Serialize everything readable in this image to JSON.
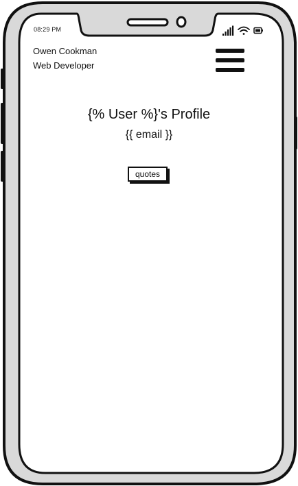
{
  "status_bar": {
    "time": "08:29 PM",
    "icons": [
      "signal-icon",
      "wifi-icon",
      "battery-icon"
    ]
  },
  "header": {
    "name": "Owen Cookman",
    "role": "Web Developer",
    "menu_icon": "hamburger-menu-icon"
  },
  "profile": {
    "title": "{% User %}'s Profile",
    "email": "{{ email }}"
  },
  "actions": {
    "quotes_label": "quotes"
  },
  "colors": {
    "frame_fill": "#d9d9d9",
    "outline": "#111111",
    "screen": "#ffffff"
  }
}
